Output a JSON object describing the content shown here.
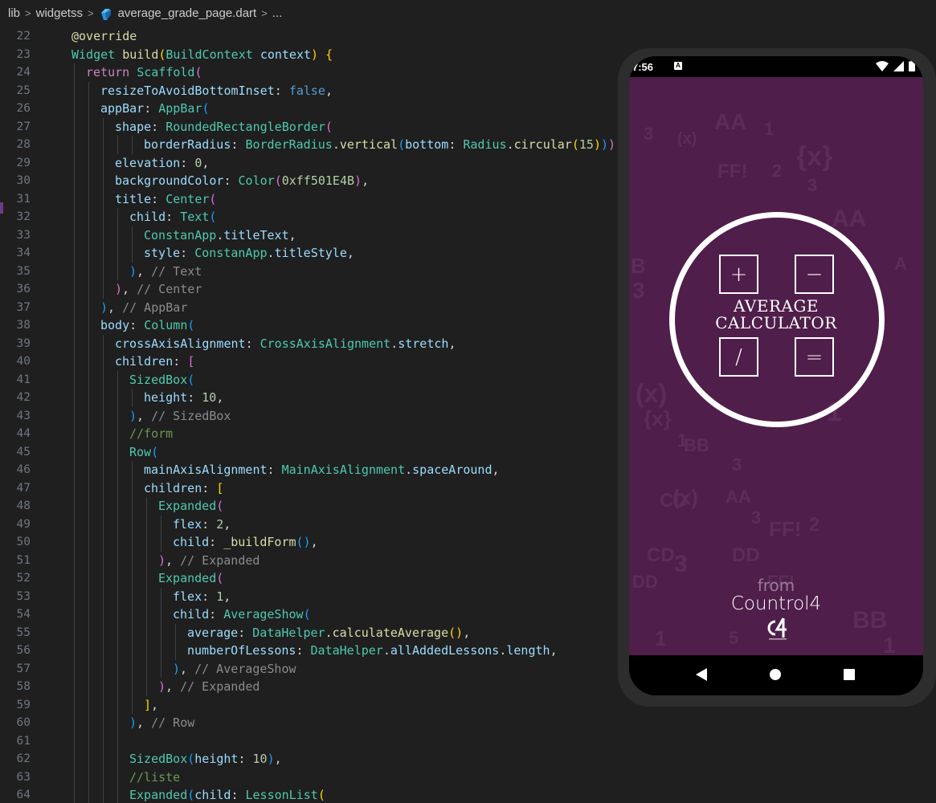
{
  "breadcrumb": {
    "items": [
      "lib",
      "widgetss",
      "average_grade_page.dart",
      "..."
    ]
  },
  "editor": {
    "lines": [
      {
        "n": "22",
        "indent": 0,
        "segs": [
          {
            "t": "@override",
            "c": "k-fn"
          }
        ]
      },
      {
        "n": "23",
        "indent": 0,
        "segs": [
          {
            "t": "Widget ",
            "c": "k-type"
          },
          {
            "t": "build",
            "c": "k-fn"
          },
          {
            "t": "(",
            "c": "k-p1"
          },
          {
            "t": "BuildContext ",
            "c": "k-type"
          },
          {
            "t": "context",
            "c": "k-prop"
          },
          {
            "t": ") {",
            "c": "k-p1"
          }
        ]
      },
      {
        "n": "24",
        "indent": 1,
        "segs": [
          {
            "t": "return ",
            "c": "k-kw"
          },
          {
            "t": "Scaffold",
            "c": "k-type"
          },
          {
            "t": "(",
            "c": "k-p2"
          }
        ]
      },
      {
        "n": "25",
        "indent": 2,
        "segs": [
          {
            "t": "resizeToAvoidBottomInset",
            "c": "k-prop"
          },
          {
            "t": ": ",
            "c": "k-plain"
          },
          {
            "t": "false",
            "c": "k-bool"
          },
          {
            "t": ",",
            "c": "k-plain"
          }
        ]
      },
      {
        "n": "26",
        "indent": 2,
        "segs": [
          {
            "t": "appBar",
            "c": "k-prop"
          },
          {
            "t": ": ",
            "c": "k-plain"
          },
          {
            "t": "AppBar",
            "c": "k-type"
          },
          {
            "t": "(",
            "c": "k-p3"
          }
        ]
      },
      {
        "n": "27",
        "indent": 3,
        "segs": [
          {
            "t": "shape",
            "c": "k-prop"
          },
          {
            "t": ": ",
            "c": "k-plain"
          },
          {
            "t": "RoundedRectangleBorder",
            "c": "k-type"
          },
          {
            "t": "(",
            "c": "k-p2"
          }
        ]
      },
      {
        "n": "28",
        "indent": 5,
        "segs": [
          {
            "t": "borderRadius",
            "c": "k-prop"
          },
          {
            "t": ": ",
            "c": "k-plain"
          },
          {
            "t": "BorderRadius",
            "c": "k-type"
          },
          {
            "t": ".",
            "c": "k-plain"
          },
          {
            "t": "vertical",
            "c": "k-fn"
          },
          {
            "t": "(",
            "c": "k-p3"
          },
          {
            "t": "bottom",
            "c": "k-prop"
          },
          {
            "t": ": ",
            "c": "k-plain"
          },
          {
            "t": "Radius",
            "c": "k-type"
          },
          {
            "t": ".",
            "c": "k-plain"
          },
          {
            "t": "circular",
            "c": "k-fn"
          },
          {
            "t": "(",
            "c": "k-p1"
          },
          {
            "t": "15",
            "c": "k-num"
          },
          {
            "t": ")",
            "c": "k-p1"
          },
          {
            "t": ")",
            "c": "k-p3"
          },
          {
            "t": ")",
            "c": "k-p2"
          },
          {
            "t": ",",
            "c": "k-plain"
          }
        ]
      },
      {
        "n": "29",
        "indent": 3,
        "segs": [
          {
            "t": "elevation",
            "c": "k-prop"
          },
          {
            "t": ": ",
            "c": "k-plain"
          },
          {
            "t": "0",
            "c": "k-num"
          },
          {
            "t": ",",
            "c": "k-plain"
          }
        ]
      },
      {
        "n": "30",
        "indent": 3,
        "segs": [
          {
            "t": "backgroundColor",
            "c": "k-prop"
          },
          {
            "t": ": ",
            "c": "k-plain"
          },
          {
            "t": "Color",
            "c": "k-type"
          },
          {
            "t": "(",
            "c": "k-p2"
          },
          {
            "t": "0xff501E4B",
            "c": "k-num"
          },
          {
            "t": ")",
            "c": "k-p2"
          },
          {
            "t": ",",
            "c": "k-plain"
          }
        ]
      },
      {
        "n": "31",
        "indent": 3,
        "segs": [
          {
            "t": "title",
            "c": "k-prop"
          },
          {
            "t": ": ",
            "c": "k-plain"
          },
          {
            "t": "Center",
            "c": "k-type"
          },
          {
            "t": "(",
            "c": "k-p2"
          }
        ]
      },
      {
        "n": "32",
        "indent": 4,
        "segs": [
          {
            "t": "child",
            "c": "k-prop"
          },
          {
            "t": ": ",
            "c": "k-plain"
          },
          {
            "t": "Text",
            "c": "k-type"
          },
          {
            "t": "(",
            "c": "k-p3"
          }
        ]
      },
      {
        "n": "33",
        "indent": 5,
        "segs": [
          {
            "t": "ConstanApp",
            "c": "k-type"
          },
          {
            "t": ".",
            "c": "k-plain"
          },
          {
            "t": "titleText",
            "c": "k-prop"
          },
          {
            "t": ",",
            "c": "k-plain"
          }
        ]
      },
      {
        "n": "34",
        "indent": 5,
        "segs": [
          {
            "t": "style",
            "c": "k-prop"
          },
          {
            "t": ": ",
            "c": "k-plain"
          },
          {
            "t": "ConstanApp",
            "c": "k-type"
          },
          {
            "t": ".",
            "c": "k-plain"
          },
          {
            "t": "titleStyle",
            "c": "k-prop"
          },
          {
            "t": ",",
            "c": "k-plain"
          }
        ]
      },
      {
        "n": "35",
        "indent": 4,
        "segs": [
          {
            "t": ")",
            "c": "k-p3"
          },
          {
            "t": ", ",
            "c": "k-plain"
          },
          {
            "t": "// Text",
            "c": "k-gcmt"
          }
        ]
      },
      {
        "n": "36",
        "indent": 3,
        "segs": [
          {
            "t": ")",
            "c": "k-p2"
          },
          {
            "t": ", ",
            "c": "k-plain"
          },
          {
            "t": "// Center",
            "c": "k-gcmt"
          }
        ]
      },
      {
        "n": "37",
        "indent": 2,
        "segs": [
          {
            "t": ")",
            "c": "k-p3"
          },
          {
            "t": ", ",
            "c": "k-plain"
          },
          {
            "t": "// AppBar",
            "c": "k-gcmt"
          }
        ]
      },
      {
        "n": "38",
        "indent": 2,
        "segs": [
          {
            "t": "body",
            "c": "k-prop"
          },
          {
            "t": ": ",
            "c": "k-plain"
          },
          {
            "t": "Column",
            "c": "k-type"
          },
          {
            "t": "(",
            "c": "k-p3"
          }
        ]
      },
      {
        "n": "39",
        "indent": 3,
        "segs": [
          {
            "t": "crossAxisAlignment",
            "c": "k-prop"
          },
          {
            "t": ": ",
            "c": "k-plain"
          },
          {
            "t": "CrossAxisAlignment",
            "c": "k-type"
          },
          {
            "t": ".",
            "c": "k-plain"
          },
          {
            "t": "stretch",
            "c": "k-prop"
          },
          {
            "t": ",",
            "c": "k-plain"
          }
        ]
      },
      {
        "n": "40",
        "indent": 3,
        "segs": [
          {
            "t": "children",
            "c": "k-prop"
          },
          {
            "t": ": ",
            "c": "k-plain"
          },
          {
            "t": "[",
            "c": "k-p2"
          }
        ]
      },
      {
        "n": "41",
        "indent": 4,
        "segs": [
          {
            "t": "SizedBox",
            "c": "k-type"
          },
          {
            "t": "(",
            "c": "k-p3"
          }
        ]
      },
      {
        "n": "42",
        "indent": 5,
        "segs": [
          {
            "t": "height",
            "c": "k-prop"
          },
          {
            "t": ": ",
            "c": "k-plain"
          },
          {
            "t": "10",
            "c": "k-num"
          },
          {
            "t": ",",
            "c": "k-plain"
          }
        ]
      },
      {
        "n": "43",
        "indent": 4,
        "segs": [
          {
            "t": ")",
            "c": "k-p3"
          },
          {
            "t": ", ",
            "c": "k-plain"
          },
          {
            "t": "// SizedBox",
            "c": "k-gcmt"
          }
        ]
      },
      {
        "n": "44",
        "indent": 4,
        "segs": [
          {
            "t": "//form",
            "c": "k-cmt"
          }
        ]
      },
      {
        "n": "45",
        "indent": 4,
        "segs": [
          {
            "t": "Row",
            "c": "k-type"
          },
          {
            "t": "(",
            "c": "k-p3"
          }
        ]
      },
      {
        "n": "46",
        "indent": 5,
        "segs": [
          {
            "t": "mainAxisAlignment",
            "c": "k-prop"
          },
          {
            "t": ": ",
            "c": "k-plain"
          },
          {
            "t": "MainAxisAlignment",
            "c": "k-type"
          },
          {
            "t": ".",
            "c": "k-plain"
          },
          {
            "t": "spaceAround",
            "c": "k-prop"
          },
          {
            "t": ",",
            "c": "k-plain"
          }
        ]
      },
      {
        "n": "47",
        "indent": 5,
        "segs": [
          {
            "t": "children",
            "c": "k-prop"
          },
          {
            "t": ": ",
            "c": "k-plain"
          },
          {
            "t": "[",
            "c": "k-p1"
          }
        ]
      },
      {
        "n": "48",
        "indent": 6,
        "segs": [
          {
            "t": "Expanded",
            "c": "k-type"
          },
          {
            "t": "(",
            "c": "k-p2"
          }
        ]
      },
      {
        "n": "49",
        "indent": 7,
        "segs": [
          {
            "t": "flex",
            "c": "k-prop"
          },
          {
            "t": ": ",
            "c": "k-plain"
          },
          {
            "t": "2",
            "c": "k-num"
          },
          {
            "t": ",",
            "c": "k-plain"
          }
        ]
      },
      {
        "n": "50",
        "indent": 7,
        "segs": [
          {
            "t": "child",
            "c": "k-prop"
          },
          {
            "t": ": ",
            "c": "k-plain"
          },
          {
            "t": "_buildForm",
            "c": "k-fn"
          },
          {
            "t": "()",
            "c": "k-p3"
          },
          {
            "t": ",",
            "c": "k-plain"
          }
        ]
      },
      {
        "n": "51",
        "indent": 6,
        "segs": [
          {
            "t": ")",
            "c": "k-p2"
          },
          {
            "t": ", ",
            "c": "k-plain"
          },
          {
            "t": "// Expanded",
            "c": "k-gcmt"
          }
        ]
      },
      {
        "n": "52",
        "indent": 6,
        "segs": [
          {
            "t": "Expanded",
            "c": "k-type"
          },
          {
            "t": "(",
            "c": "k-p2"
          }
        ]
      },
      {
        "n": "53",
        "indent": 7,
        "segs": [
          {
            "t": "flex",
            "c": "k-prop"
          },
          {
            "t": ": ",
            "c": "k-plain"
          },
          {
            "t": "1",
            "c": "k-num"
          },
          {
            "t": ",",
            "c": "k-plain"
          }
        ]
      },
      {
        "n": "54",
        "indent": 7,
        "segs": [
          {
            "t": "child",
            "c": "k-prop"
          },
          {
            "t": ": ",
            "c": "k-plain"
          },
          {
            "t": "AverageShow",
            "c": "k-type"
          },
          {
            "t": "(",
            "c": "k-p3"
          }
        ]
      },
      {
        "n": "55",
        "indent": 8,
        "segs": [
          {
            "t": "average",
            "c": "k-prop"
          },
          {
            "t": ": ",
            "c": "k-plain"
          },
          {
            "t": "DataHelper",
            "c": "k-type"
          },
          {
            "t": ".",
            "c": "k-plain"
          },
          {
            "t": "calculateAverage",
            "c": "k-fn"
          },
          {
            "t": "()",
            "c": "k-p1"
          },
          {
            "t": ",",
            "c": "k-plain"
          }
        ]
      },
      {
        "n": "56",
        "indent": 8,
        "segs": [
          {
            "t": "numberOfLessons",
            "c": "k-prop"
          },
          {
            "t": ": ",
            "c": "k-plain"
          },
          {
            "t": "DataHelper",
            "c": "k-type"
          },
          {
            "t": ".",
            "c": "k-plain"
          },
          {
            "t": "allAddedLessons",
            "c": "k-prop"
          },
          {
            "t": ".",
            "c": "k-plain"
          },
          {
            "t": "length",
            "c": "k-prop"
          },
          {
            "t": ",",
            "c": "k-plain"
          }
        ]
      },
      {
        "n": "57",
        "indent": 7,
        "segs": [
          {
            "t": ")",
            "c": "k-p3"
          },
          {
            "t": ", ",
            "c": "k-plain"
          },
          {
            "t": "// AverageShow",
            "c": "k-gcmt"
          }
        ]
      },
      {
        "n": "58",
        "indent": 6,
        "segs": [
          {
            "t": ")",
            "c": "k-p2"
          },
          {
            "t": ", ",
            "c": "k-plain"
          },
          {
            "t": "// Expanded",
            "c": "k-gcmt"
          }
        ]
      },
      {
        "n": "59",
        "indent": 5,
        "segs": [
          {
            "t": "]",
            "c": "k-p1"
          },
          {
            "t": ",",
            "c": "k-plain"
          }
        ]
      },
      {
        "n": "60",
        "indent": 4,
        "segs": [
          {
            "t": ")",
            "c": "k-p3"
          },
          {
            "t": ", ",
            "c": "k-plain"
          },
          {
            "t": "// Row",
            "c": "k-gcmt"
          }
        ]
      },
      {
        "n": "61",
        "indent": 4,
        "segs": []
      },
      {
        "n": "62",
        "indent": 4,
        "segs": [
          {
            "t": "SizedBox",
            "c": "k-type"
          },
          {
            "t": "(",
            "c": "k-p3"
          },
          {
            "t": "height",
            "c": "k-prop"
          },
          {
            "t": ": ",
            "c": "k-plain"
          },
          {
            "t": "10",
            "c": "k-num"
          },
          {
            "t": ")",
            "c": "k-p3"
          },
          {
            "t": ",",
            "c": "k-plain"
          }
        ]
      },
      {
        "n": "63",
        "indent": 4,
        "segs": [
          {
            "t": "//liste",
            "c": "k-cmt"
          }
        ]
      },
      {
        "n": "64",
        "indent": 4,
        "segs": [
          {
            "t": "Expanded",
            "c": "k-type"
          },
          {
            "t": "(",
            "c": "k-p3"
          },
          {
            "t": "child",
            "c": "k-prop"
          },
          {
            "t": ": ",
            "c": "k-plain"
          },
          {
            "t": "LessonList",
            "c": "k-type"
          },
          {
            "t": "(",
            "c": "k-p1"
          }
        ]
      }
    ]
  },
  "phone": {
    "status_time": "7:56",
    "status_notification": "A",
    "splash": {
      "op_plus": "+",
      "op_minus": "−",
      "op_divide": "/",
      "op_equals": "=",
      "title_line1": "AVERAGE",
      "title_line2": "CALCULATOR",
      "from_label": "from",
      "brand_name": "Countrol4",
      "background_color": "#501e4b",
      "background_glyphs": [
        "3",
        "(x)",
        "AA",
        "1",
        "{x}",
        "FF!",
        "2",
        "3",
        "AA",
        "B",
        "3",
        "A",
        "(x)",
        "{x}",
        "1",
        "CD",
        "1",
        "BB",
        "3",
        "(x)",
        "AA",
        "FF!",
        "2",
        "CD",
        "3",
        "DD",
        "FF!",
        "BB",
        "1",
        "5",
        "3",
        "DD",
        "1"
      ]
    },
    "nav": {
      "back_icon": "back-triangle-icon",
      "home_icon": "home-circle-icon",
      "recents_icon": "recents-square-icon"
    }
  }
}
